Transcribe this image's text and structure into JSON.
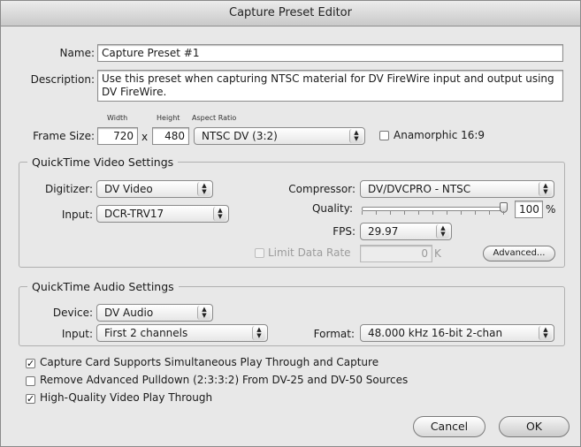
{
  "window": {
    "title": "Capture Preset Editor"
  },
  "name": {
    "label": "Name:",
    "value": "Capture Preset #1"
  },
  "description": {
    "label": "Description:",
    "value": "Use this preset when capturing NTSC material for DV FireWire input and output using DV FireWire."
  },
  "frame_size": {
    "label": "Frame Size:",
    "width_caption": "Width",
    "height_caption": "Height",
    "aspect_caption": "Aspect Ratio",
    "width": "720",
    "separator": "x",
    "height": "480",
    "aspect_ratio": "NTSC DV (3:2)",
    "anamorphic_label": "Anamorphic 16:9",
    "anamorphic_checked": false
  },
  "video": {
    "title": "QuickTime Video Settings",
    "digitizer_label": "Digitizer:",
    "digitizer": "DV Video",
    "input_label": "Input:",
    "input": "DCR-TRV17",
    "compressor_label": "Compressor:",
    "compressor": "DV/DVCPRO - NTSC",
    "quality_label": "Quality:",
    "quality_value": "100",
    "quality_unit": "%",
    "quality_fraction": 1.0,
    "fps_label": "FPS:",
    "fps": "29.97",
    "limit_label": "Limit Data Rate",
    "limit_checked": false,
    "limit_value": "0",
    "limit_unit": "K",
    "advanced_label": "Advanced..."
  },
  "audio": {
    "title": "QuickTime Audio Settings",
    "device_label": "Device:",
    "device": "DV Audio",
    "input_label": "Input:",
    "input": "First 2 channels",
    "format_label": "Format:",
    "format": "48.000 kHz 16-bit 2-chan"
  },
  "options": [
    {
      "label": "Capture Card Supports Simultaneous Play Through and Capture",
      "checked": true
    },
    {
      "label": "Remove Advanced Pulldown (2:3:3:2) From DV-25 and DV-50 Sources",
      "checked": false
    },
    {
      "label": "High-Quality Video Play Through",
      "checked": true
    }
  ],
  "buttons": {
    "cancel": "Cancel",
    "ok": "OK"
  },
  "glyphs": {
    "check": "✓",
    "arrows_up": "▲",
    "arrows_down": "▼"
  }
}
